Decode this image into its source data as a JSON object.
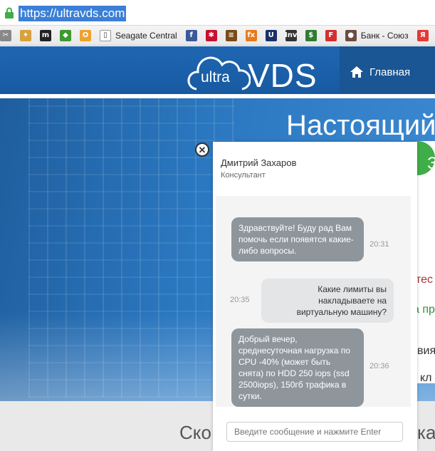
{
  "browser": {
    "url": "https://ultravds.com",
    "bookmarks": [
      {
        "icon": "wrench-icon",
        "color": "#888888",
        "glyph": "✂"
      },
      {
        "icon": "puzzle-icon",
        "color": "#d7a23c",
        "glyph": "✦"
      },
      {
        "icon": "m-icon",
        "color": "#222222",
        "glyph": "m"
      },
      {
        "icon": "leaf-icon",
        "color": "#3c9a2e",
        "glyph": "◆"
      },
      {
        "icon": "o-icon",
        "color": "#f0a22e",
        "glyph": "O"
      },
      {
        "icon": "page-icon",
        "color": "#ffffff",
        "glyph": "▯",
        "label": "Seagate Central"
      },
      {
        "icon": "facebook-icon",
        "color": "#3b5998",
        "glyph": "f"
      },
      {
        "icon": "star-badge-icon",
        "color": "#c8102e",
        "glyph": "✱"
      },
      {
        "icon": "chart-icon",
        "color": "#7a4b1a",
        "glyph": "≡"
      },
      {
        "icon": "fx-icon",
        "color": "#e87a1c",
        "glyph": "fx"
      },
      {
        "icon": "u-icon",
        "color": "#1b2f6b",
        "glyph": "U"
      },
      {
        "icon": "inv-icon",
        "color": "#333333",
        "glyph": "Inv"
      },
      {
        "icon": "dollar-icon",
        "color": "#2f7d32",
        "glyph": "$"
      },
      {
        "icon": "f-icon",
        "color": "#d32f2f",
        "glyph": "F"
      },
      {
        "icon": "person-icon",
        "color": "#6d4c41",
        "glyph": "●",
        "label": "Банк - Союз"
      },
      {
        "icon": "ya-icon",
        "color": "#e53935",
        "glyph": "Я"
      }
    ]
  },
  "site": {
    "logo_small": "ultra",
    "logo_big": "VDS",
    "nav_home": "Главная",
    "hero_title": "Настоящий",
    "hero_right_fragments": [
      "З",
      "тес",
      "а пр",
      "вия",
      "кл"
    ],
    "bottom_text": "Ско",
    "bottom_text_end": "ка"
  },
  "chat": {
    "agent_name": "Дмитрий Захаров",
    "agent_role": "Консультант",
    "messages": [
      {
        "direction": "in",
        "text": "Здравствуйте! Буду рад Вам помочь если появятся какие-либо вопросы.",
        "time": "20:31"
      },
      {
        "direction": "out",
        "text": "Какие лимиты вы накладываете на виртуальную машину?",
        "time": "20:35"
      },
      {
        "direction": "in",
        "text": "Добрый вечер, среднесуточная нагрузка по CPU -40% (может быть снята) по HDD 250 iops (ssd 2500iops), 150гб трафика в сутки.",
        "time": "20:36"
      }
    ],
    "input_placeholder": "Введите сообщение и нажмите Enter"
  }
}
